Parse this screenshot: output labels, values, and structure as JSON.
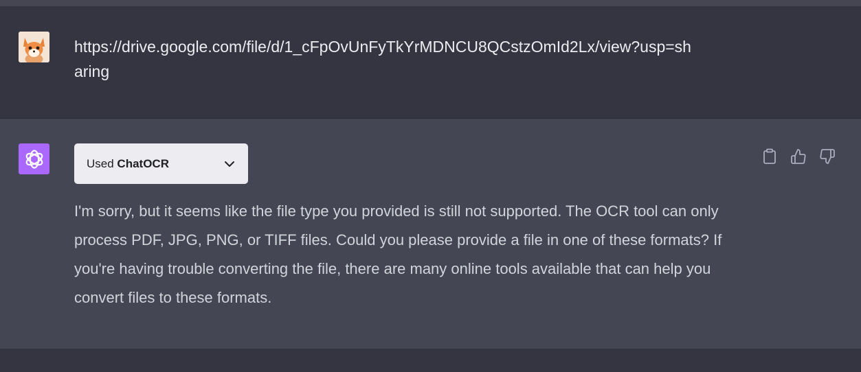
{
  "user_message": {
    "text": "https://drive.google.com/file/d/1_cFpOvUnFyTkYrMDNCU8QCstzOmId2Lx/view?usp=sharing",
    "avatar_icon": "fox-avatar"
  },
  "assistant_message": {
    "avatar_icon": "openai-logo-icon",
    "avatar_color": "#ab68ff",
    "plugin_prefix": "Used",
    "plugin_name": "ChatOCR",
    "text": "I'm sorry, but it seems like the file type you provided is still not supported. The OCR tool can only process PDF, JPG, PNG, or TIFF files. Could you please provide a file in one of these formats? If you're having trouble converting the file, there are many online tools available that can help you convert files to these formats.",
    "actions": [
      "copy-icon",
      "thumbs-up-icon",
      "thumbs-down-icon"
    ]
  },
  "colors": {
    "background": "#343541",
    "assistant_background": "#444654",
    "text": "#ececf1",
    "assistant_text": "#d1d5db"
  }
}
